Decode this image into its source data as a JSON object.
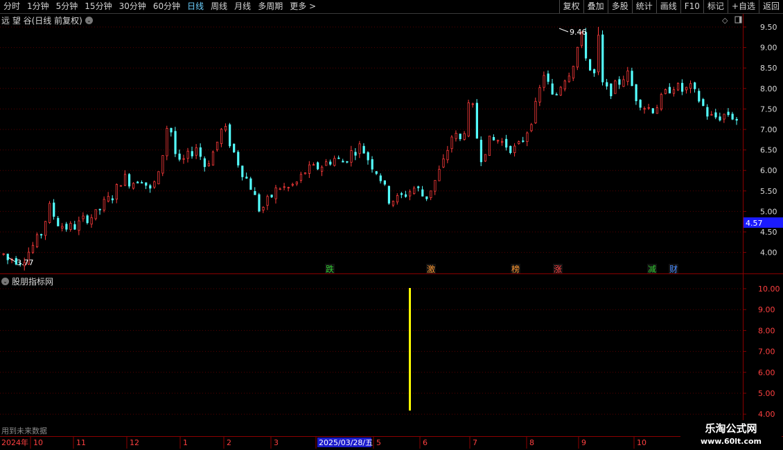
{
  "toolbar": {
    "periods": [
      "分时",
      "1分钟",
      "5分钟",
      "15分钟",
      "30分钟",
      "60分钟",
      "日线",
      "周线",
      "月线",
      "多周期",
      "更多 >"
    ],
    "active_period": "日线",
    "right_buttons": [
      "复权",
      "叠加",
      "多股",
      "统计",
      "画线",
      "F10",
      "标记",
      "+自选",
      "返回"
    ]
  },
  "chart": {
    "title": "远 望 谷(日线 前复权)",
    "price_labels": [
      "9.50",
      "9.00",
      "8.50",
      "8.00",
      "7.50",
      "7.00",
      "6.50",
      "6.00",
      "5.50",
      "5.00",
      "4.50",
      "4.00"
    ],
    "current_price": "4.57",
    "high_label": "9.46",
    "low_label": "3.77",
    "signals": [
      {
        "text": "跌",
        "color": "#33cc33"
      },
      {
        "text": "激",
        "color": "#ff9933"
      },
      {
        "text": "榜",
        "color": "#ff9933"
      },
      {
        "text": "涨",
        "color": "#ff4444"
      },
      {
        "text": "减",
        "color": "#33cc33"
      },
      {
        "text": "财",
        "color": "#4a8cff"
      }
    ]
  },
  "indicator": {
    "title": "股朋指标网",
    "labels": [
      "10.00",
      "9.00",
      "8.00",
      "7.00",
      "6.00",
      "5.00",
      "4.00"
    ]
  },
  "timeline": {
    "year_label": "2024年",
    "months": [
      "10",
      "11",
      "12",
      "1",
      "2",
      "3",
      "2025/03/28/五",
      "5",
      "6",
      "7",
      "8",
      "9",
      "10"
    ]
  },
  "future_text": "用到未来数据",
  "watermark": {
    "line1": "乐淘公式网",
    "line2": "www.60lt.com"
  },
  "chart_data": {
    "type": "candlestick",
    "ylim": [
      3.7,
      9.6
    ],
    "close_path": [
      3.95,
      3.85,
      3.8,
      4.1,
      4.4,
      5.1,
      4.7,
      4.6,
      4.65,
      4.85,
      4.9,
      5.2,
      5.4,
      5.85,
      5.7,
      5.85,
      5.5,
      5.9,
      7.3,
      6.1,
      6.3,
      6.6,
      6.1,
      6.5,
      7.1,
      6.5,
      6.0,
      5.6,
      5.0,
      5.3,
      5.6,
      5.55,
      5.7,
      6.0,
      6.05,
      6.15,
      6.3,
      6.2,
      6.45,
      6.6,
      6.2,
      5.9,
      5.3,
      5.3,
      5.45,
      5.6,
      5.3,
      5.7,
      6.2,
      6.9,
      6.7,
      7.8,
      6.3,
      6.7,
      6.75,
      6.6,
      6.5,
      6.9,
      7.5,
      8.4,
      7.7,
      8.2,
      8.5,
      9.3,
      8.45,
      8.2,
      7.9,
      8.1,
      8.4,
      7.8,
      7.55,
      7.5,
      7.8,
      8.1,
      7.95,
      8.0,
      7.7,
      7.3,
      7.3,
      7.4,
      7.25
    ]
  }
}
